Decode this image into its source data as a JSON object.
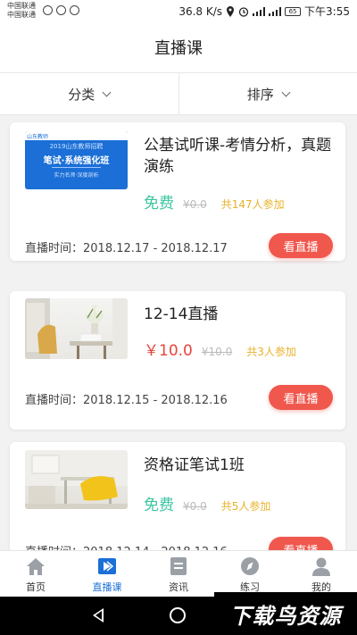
{
  "status_bar": {
    "carrier_1": "中国联通",
    "carrier_2": "中国联通",
    "net_speed": "36.8 K/s",
    "battery": "65",
    "time": "下午3:55"
  },
  "header": {
    "title": "直播课"
  },
  "filters": {
    "category_label": "分类",
    "sort_label": "排序"
  },
  "courses": [
    {
      "title": "公基试听课-考情分析，真题演练",
      "price": "免费",
      "price_type": "free",
      "original_price": "¥0.0",
      "participants": "共147人参加",
      "time": "直播时间：2018.12.17 - 2018.12.17",
      "button": "看直播",
      "thumb": {
        "badge": "山东教师",
        "subtitle": "2019山东教师招聘",
        "main": "笔试·系统强化班",
        "tagline": "实力名师·深度剖析"
      }
    },
    {
      "title": "12-14直播",
      "price": "￥10.0",
      "price_type": "paid",
      "original_price": "¥10.0",
      "participants": "共3人参加",
      "time": "直播时间：2018.12.15 - 2018.12.16",
      "button": "看直播"
    },
    {
      "title": "资格证笔试1班",
      "price": "免费",
      "price_type": "free",
      "original_price": "¥0.0",
      "participants": "共5人参加",
      "time": "直播时间：2018.12.14 - 2018.12.16",
      "button": "看直播"
    }
  ],
  "tabbar": {
    "items": [
      {
        "label": "首页",
        "icon": "home-icon"
      },
      {
        "label": "直播课",
        "icon": "live-icon",
        "active": true
      },
      {
        "label": "资讯",
        "icon": "news-icon"
      },
      {
        "label": "练习",
        "icon": "compass-icon"
      },
      {
        "label": "我的",
        "icon": "user-icon"
      }
    ]
  },
  "watermark": "下载鸟资源",
  "colors": {
    "accent": "#1b6fd6",
    "free": "#3cc5a1",
    "paid": "#e6453c",
    "button": "#f0584d",
    "count": "#e8b22a"
  }
}
